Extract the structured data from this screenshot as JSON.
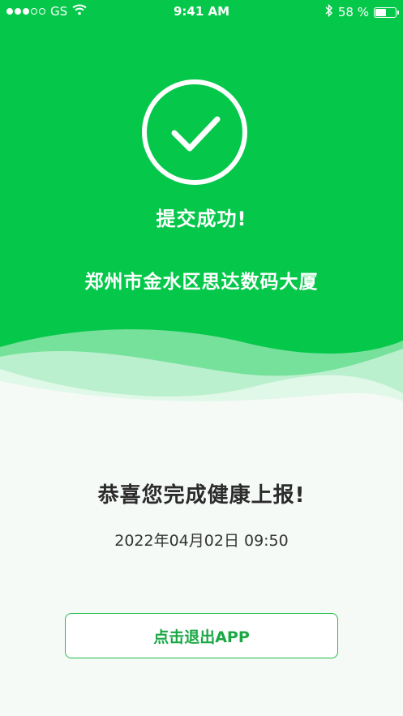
{
  "status_bar": {
    "signal_dots": [
      true,
      true,
      true,
      false,
      false
    ],
    "carrier": "GS",
    "wifi_icon": "wifi-icon",
    "time": "9:41 AM",
    "bluetooth_icon": "bluetooth-icon",
    "battery_percent_text": "58 %",
    "battery_level": 0.58
  },
  "header": {
    "icon": "check-circle-icon",
    "title": "提交成功!",
    "location": "郑州市金水区思达数码大厦"
  },
  "main": {
    "message": "恭喜您完成健康上报!",
    "datetime": "2022年04月02日  09:50",
    "exit_button_label": "点击退出APP"
  },
  "colors": {
    "primary_green": "#05c84a",
    "background": "#f6faf7",
    "button_text": "#1aa845"
  }
}
